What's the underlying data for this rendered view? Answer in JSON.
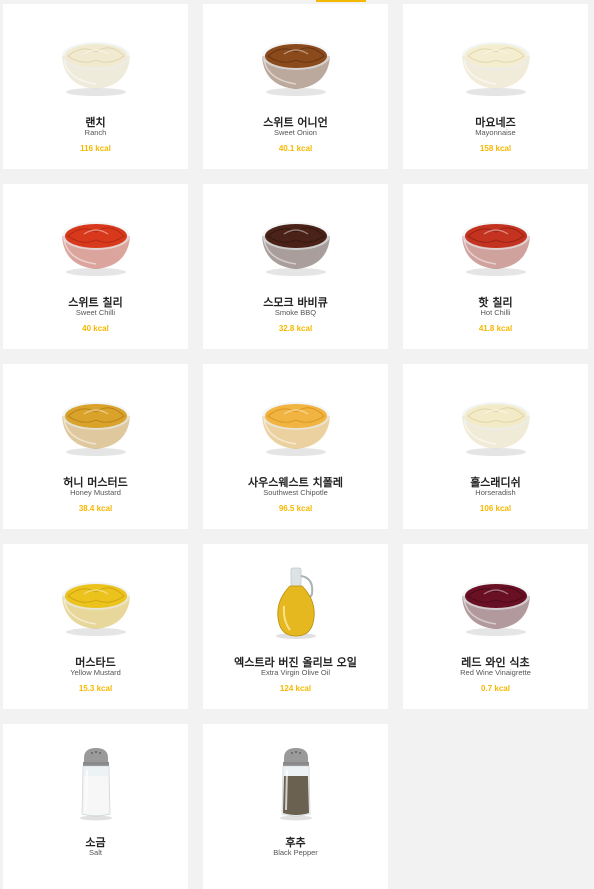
{
  "sauces": [
    {
      "kr": "랜치",
      "en": "Ranch",
      "kcal": "116 kcal",
      "type": "bowl",
      "color": "#f2ead0",
      "rim": "#d9cfa8"
    },
    {
      "kr": "스위트 어니언",
      "en": "Sweet Onion",
      "kcal": "40.1 kcal",
      "type": "bowl",
      "color": "#8a4a1c",
      "rim": "#5c2e10"
    },
    {
      "kr": "마요네즈",
      "en": "Mayonnaise",
      "kcal": "158 kcal",
      "type": "bowl",
      "color": "#f4edcf",
      "rim": "#dcd2a6"
    },
    {
      "kr": "스위트 칠리",
      "en": "Sweet Chilli",
      "kcal": "40 kcal",
      "type": "bowl",
      "color": "#d8391c",
      "rim": "#a82410"
    },
    {
      "kr": "스모크 바비큐",
      "en": "Smoke BBQ",
      "kcal": "32.8 kcal",
      "type": "bowl",
      "color": "#4a2218",
      "rim": "#2e140e"
    },
    {
      "kr": "핫 칠리",
      "en": "Hot Chilli",
      "kcal": "41.8 kcal",
      "type": "bowl",
      "color": "#c43220",
      "rim": "#8e1e12"
    },
    {
      "kr": "허니 머스터드",
      "en": "Honey Mustard",
      "kcal": "38.4 kcal",
      "type": "bowl",
      "color": "#d9a22a",
      "rim": "#b07a14"
    },
    {
      "kr": "사우스웨스트 치폴레",
      "en": "Southwest Chipotle",
      "kcal": "96.5 kcal",
      "type": "bowl",
      "color": "#f2b440",
      "rim": "#d18f1a"
    },
    {
      "kr": "홀스래디쉬",
      "en": "Horseradish",
      "kcal": "106 kcal",
      "type": "bowl",
      "color": "#f3ebc8",
      "rim": "#dbcf9e"
    },
    {
      "kr": "머스타드",
      "en": "Yellow Mustard",
      "kcal": "15.3 kcal",
      "type": "bowl",
      "color": "#ecc21c",
      "rim": "#c99e0c"
    },
    {
      "kr": "엑스트라 버진 올리브 오일",
      "en": "Extra Virgin Olive Oil",
      "kcal": "124 kcal",
      "type": "bottle",
      "color": "#e6b820",
      "rim": "#b88c0c"
    },
    {
      "kr": "레드 와인 식초",
      "en": "Red Wine Vinaigrette",
      "kcal": "0.7 kcal",
      "type": "bowl",
      "color": "#6a1024",
      "rim": "#420814"
    },
    {
      "kr": "소금",
      "en": "Salt",
      "kcal": "",
      "type": "shaker",
      "color": "#f7f7f7",
      "rim": "#8a8a8a"
    },
    {
      "kr": "후추",
      "en": "Black Pepper",
      "kcal": "",
      "type": "shaker",
      "color": "#6b6150",
      "rim": "#8a8a8a"
    }
  ]
}
